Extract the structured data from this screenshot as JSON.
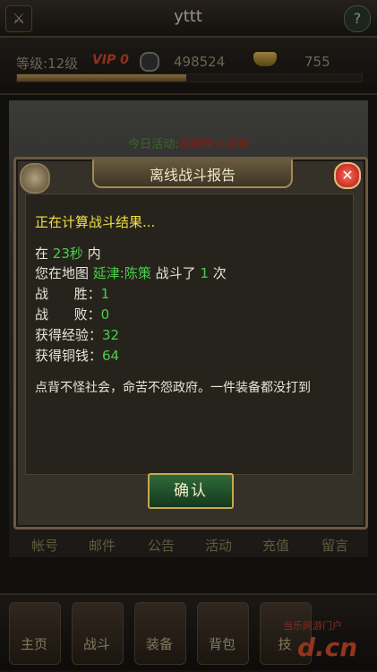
{
  "topbar": {
    "player_name": "yttt",
    "help": "?"
  },
  "stats": {
    "level": "等级:12级",
    "vip": "VIP 0",
    "coins": "498524",
    "ingots": "755",
    "exp_fraction": 0.49
  },
  "scene": {
    "event_prefix": "今日活动:",
    "event_name": "西域烽火召唤"
  },
  "menu_row": [
    "帐号",
    "邮件",
    "公告",
    "活动",
    "充值",
    "留言"
  ],
  "bottom_nav": [
    "主页",
    "战斗",
    "装备",
    "背包",
    "技"
  ],
  "watermark": {
    "line1": "当乐网游门户",
    "line2": "d.cn"
  },
  "dialog": {
    "title": "离线战斗报告",
    "calculating": "正在计算战斗结果...",
    "time_prefix": "在",
    "time_value": "23秒",
    "time_suffix": "内",
    "map_prefix": "您在地图",
    "map_name": "延津:陈策",
    "map_mid": "战斗了",
    "battles": "1",
    "map_suffix": "次",
    "win_label": "战      胜：",
    "win_value": "1",
    "lose_label": "战      败：",
    "lose_value": "0",
    "exp_label": "获得经验：",
    "exp_value": "32",
    "money_label": "获得铜钱：",
    "money_value": "64",
    "message": "点背不怪社会，命苦不怨政府。一件装备都没打到",
    "confirm": "确认",
    "close": "✕"
  }
}
